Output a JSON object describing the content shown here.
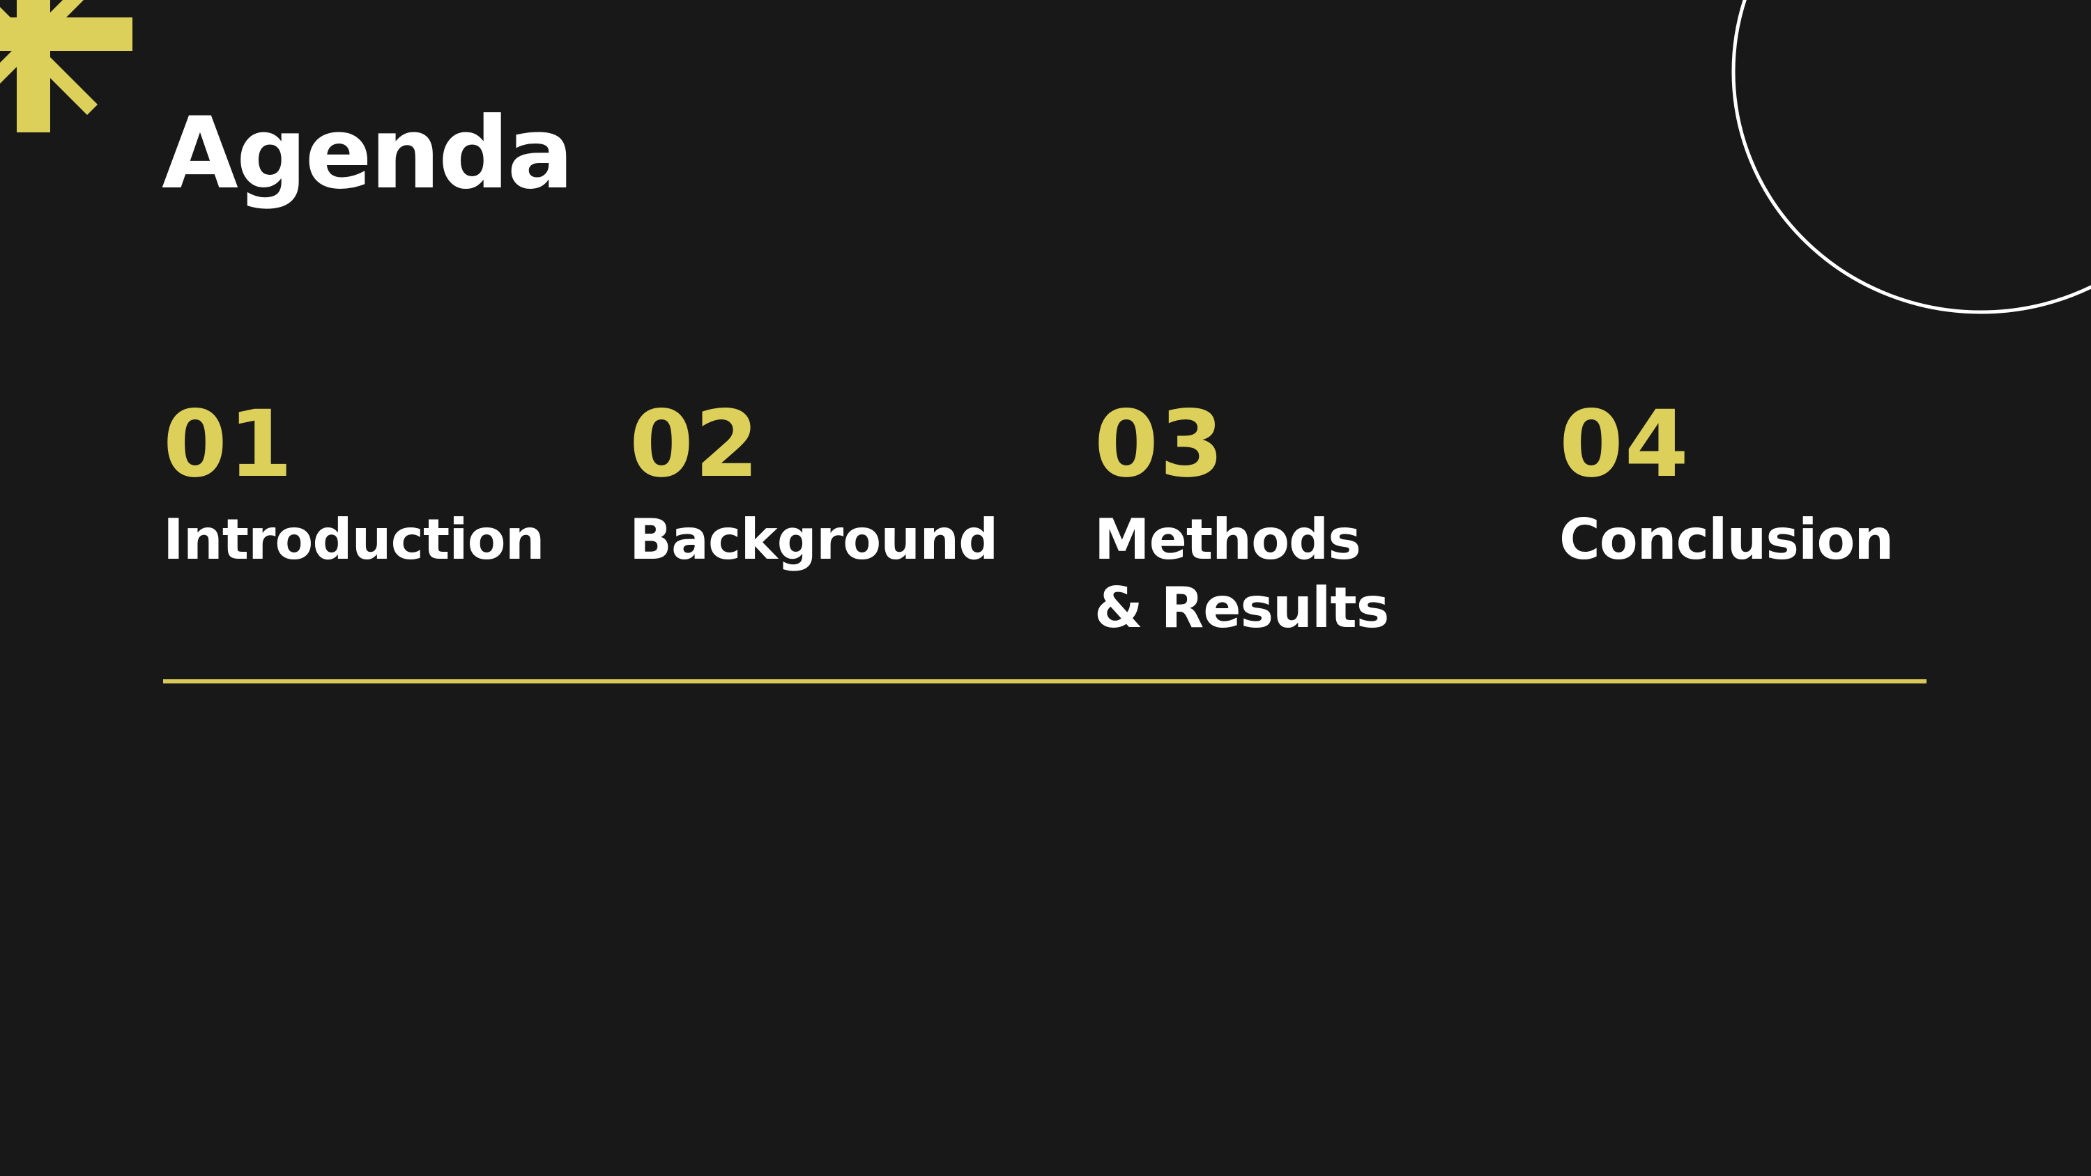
{
  "slide": {
    "title": "Agenda",
    "items": [
      {
        "number": "01",
        "label": "Introduction"
      },
      {
        "number": "02",
        "label": "Background"
      },
      {
        "number": "03",
        "label": "Methods & Results"
      },
      {
        "number": "04",
        "label": "Conclusion"
      }
    ]
  },
  "colors": {
    "background": "#181818",
    "accent": "#ddd05a",
    "text": "#ffffff",
    "outline": "#ffffff"
  },
  "decorations": {
    "corner_shape": "asterisk-icon",
    "corner_outline": "circle-outline"
  }
}
